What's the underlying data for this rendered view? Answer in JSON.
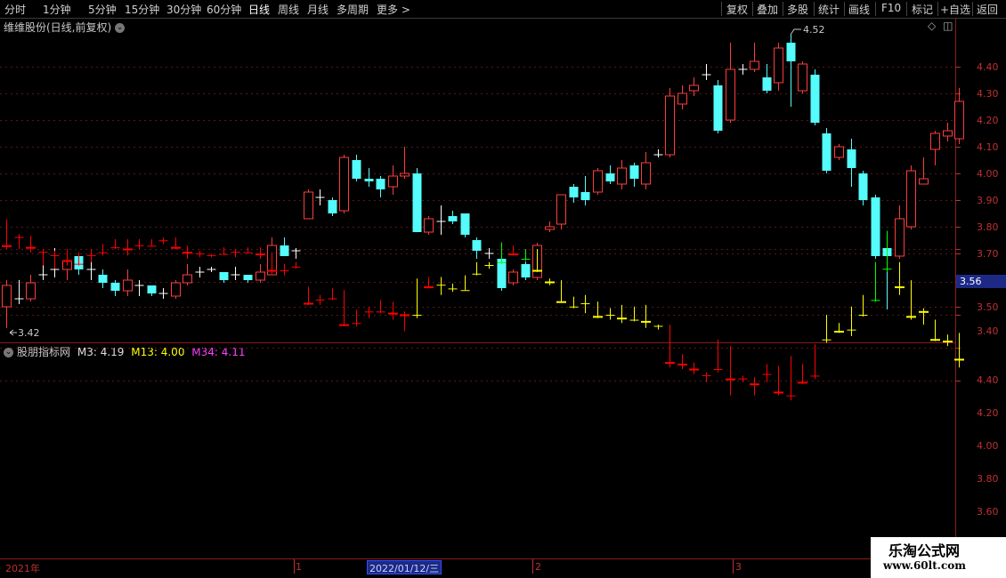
{
  "toolbar": {
    "left": [
      "分时",
      "1分钟",
      "5分钟",
      "15分钟",
      "30分钟",
      "60分钟",
      "日线",
      "周线",
      "月线",
      "多周期",
      "更多 >"
    ],
    "right": [
      "复权",
      "叠加",
      "多股",
      "统计",
      "画线",
      "F10",
      "标记",
      "+自选",
      "返回"
    ],
    "active": "日线"
  },
  "main_title": "维维股份(日线,前复权)",
  "indicator": {
    "name": "股朋指标网",
    "m3": "M3: 4.19",
    "m13": "M13: 4.00",
    "m34": "M34: 4.11"
  },
  "current_price": "3.56",
  "marks": {
    "high": "4.52",
    "low": "3.42"
  },
  "upper_axis": [
    "4.40",
    "4.30",
    "4.20",
    "4.10",
    "4.00",
    "3.90",
    "3.80",
    "3.70",
    "3.50",
    "3.40"
  ],
  "lower_axis": [
    "4.40",
    "4.20",
    "4.00",
    "3.80",
    "3.60"
  ],
  "dates": {
    "year": "2021年",
    "m1": "1",
    "m2": "2",
    "m3": "3",
    "selected": "2022/01/12/三"
  },
  "watermark": {
    "line1": "乐淘公式网",
    "line2": "www.60lt.com"
  },
  "colors": {
    "up": "#ff3c3c",
    "down_upper": "#54fcfc",
    "lower_red": "#ff0000",
    "lower_yellow": "#ffff00",
    "lower_green": "#00ff00",
    "axis": "#c03030"
  },
  "chart_data": {
    "type": "candlestick",
    "title": "维维股份(日线,前复权)",
    "ylim": [
      3.36,
      4.56
    ],
    "candles": [
      [
        3.5,
        3.58,
        3.42,
        3.6
      ],
      [
        3.53,
        3.53,
        3.51,
        3.6
      ],
      [
        3.53,
        3.59,
        3.52,
        3.62
      ],
      [
        3.62,
        3.62,
        3.6,
        3.7
      ],
      [
        3.64,
        3.64,
        3.61,
        3.72
      ],
      [
        3.64,
        3.67,
        3.6,
        3.7
      ],
      [
        3.69,
        3.64,
        3.62,
        3.7
      ],
      [
        3.64,
        3.64,
        3.6,
        3.68
      ],
      [
        3.62,
        3.59,
        3.57,
        3.64
      ],
      [
        3.59,
        3.56,
        3.54,
        3.6
      ],
      [
        3.56,
        3.6,
        3.54,
        3.64
      ],
      [
        3.58,
        3.58,
        3.54,
        3.6
      ],
      [
        3.58,
        3.55,
        3.54,
        3.58
      ],
      [
        3.55,
        3.55,
        3.53,
        3.57
      ],
      [
        3.54,
        3.59,
        3.53,
        3.6
      ],
      [
        3.59,
        3.62,
        3.58,
        3.66
      ],
      [
        3.63,
        3.63,
        3.61,
        3.65
      ],
      [
        3.64,
        3.64,
        3.63,
        3.65
      ],
      [
        3.63,
        3.6,
        3.59,
        3.63
      ],
      [
        3.62,
        3.62,
        3.6,
        3.65
      ],
      [
        3.62,
        3.6,
        3.59,
        3.62
      ],
      [
        3.6,
        3.63,
        3.59,
        3.66
      ],
      [
        3.62,
        3.73,
        3.62,
        3.76
      ],
      [
        3.73,
        3.69,
        3.69,
        3.76
      ],
      [
        3.71,
        3.71,
        3.68,
        3.72
      ],
      [
        3.83,
        3.93,
        3.83,
        3.94
      ],
      [
        3.91,
        3.91,
        3.88,
        3.94
      ],
      [
        3.9,
        3.85,
        3.84,
        3.91
      ],
      [
        3.86,
        4.06,
        3.85,
        4.07
      ],
      [
        4.05,
        3.98,
        3.97,
        4.07
      ],
      [
        3.98,
        3.97,
        3.95,
        4.02
      ],
      [
        3.98,
        3.94,
        3.91,
        3.99
      ],
      [
        3.95,
        3.99,
        3.92,
        4.03
      ],
      [
        3.99,
        4.0,
        3.98,
        4.1
      ],
      [
        4.0,
        3.78,
        3.78,
        4.02
      ],
      [
        3.78,
        3.83,
        3.77,
        3.84
      ],
      [
        3.82,
        3.82,
        3.77,
        3.88
      ],
      [
        3.84,
        3.82,
        3.81,
        3.86
      ],
      [
        3.85,
        3.77,
        3.76,
        3.85
      ],
      [
        3.75,
        3.71,
        3.68,
        3.76
      ],
      [
        3.7,
        3.7,
        3.68,
        3.72
      ],
      [
        3.68,
        3.57,
        3.56,
        3.69
      ],
      [
        3.59,
        3.63,
        3.58,
        3.64
      ],
      [
        3.66,
        3.61,
        3.6,
        3.67
      ],
      [
        3.61,
        3.73,
        3.6,
        3.74
      ],
      [
        3.79,
        3.8,
        3.78,
        3.82
      ],
      [
        3.81,
        3.92,
        3.79,
        3.92
      ],
      [
        3.95,
        3.91,
        3.89,
        3.96
      ],
      [
        3.93,
        3.9,
        3.88,
        3.99
      ],
      [
        3.93,
        4.01,
        3.92,
        4.02
      ],
      [
        4.0,
        3.97,
        3.96,
        4.03
      ],
      [
        3.96,
        4.02,
        3.94,
        4.05
      ],
      [
        4.03,
        3.98,
        3.95,
        4.04
      ],
      [
        3.96,
        4.04,
        3.94,
        4.08
      ],
      [
        4.07,
        4.07,
        4.06,
        4.09
      ],
      [
        4.07,
        4.29,
        4.06,
        4.32
      ],
      [
        4.26,
        4.3,
        4.24,
        4.33
      ],
      [
        4.31,
        4.33,
        4.29,
        4.36
      ],
      [
        4.37,
        4.37,
        4.35,
        4.41
      ],
      [
        4.33,
        4.16,
        4.15,
        4.35
      ],
      [
        4.2,
        4.39,
        4.19,
        4.49
      ],
      [
        4.39,
        4.39,
        4.37,
        4.41
      ],
      [
        4.39,
        4.42,
        4.38,
        4.49
      ],
      [
        4.36,
        4.31,
        4.3,
        4.41
      ],
      [
        4.34,
        4.47,
        4.31,
        4.49
      ],
      [
        4.49,
        4.42,
        4.25,
        4.52
      ],
      [
        4.31,
        4.41,
        4.3,
        4.42
      ],
      [
        4.37,
        4.19,
        4.18,
        4.39
      ],
      [
        4.15,
        4.01,
        4.0,
        4.17
      ],
      [
        4.06,
        4.1,
        4.05,
        4.11
      ],
      [
        4.09,
        4.02,
        3.95,
        4.13
      ],
      [
        4.0,
        3.9,
        3.88,
        4.01
      ],
      [
        3.91,
        3.69,
        3.68,
        3.92
      ],
      [
        3.72,
        3.69,
        3.49,
        3.74
      ],
      [
        3.69,
        3.83,
        3.68,
        3.88
      ],
      [
        3.8,
        4.01,
        3.79,
        4.03
      ],
      [
        3.96,
        3.98,
        3.96,
        4.06
      ],
      [
        4.09,
        4.15,
        4.03,
        4.16
      ],
      [
        4.14,
        4.16,
        4.12,
        4.19
      ],
      [
        4.13,
        4.27,
        4.11,
        4.32
      ]
    ]
  }
}
